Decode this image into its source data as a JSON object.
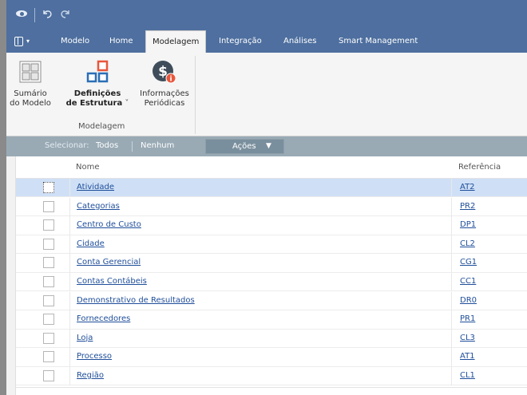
{
  "titlebar": {
    "icons": [
      "app-eye-icon",
      "undo-icon",
      "redo-icon"
    ]
  },
  "tabs": [
    {
      "label": "Modelo",
      "active": false
    },
    {
      "label": "Home",
      "active": false
    },
    {
      "label": "Modelagem",
      "active": true
    },
    {
      "label": "Integração",
      "active": false
    },
    {
      "label": "Análises",
      "active": false
    },
    {
      "label": "Smart Management",
      "active": false
    }
  ],
  "ribbon": {
    "buttons": [
      {
        "line1": "Sumário",
        "line2": "do Modelo",
        "icon": "summary-grid-icon"
      },
      {
        "line1": "Definições",
        "line2": "de Estrutura",
        "icon": "structure-icon",
        "has_dropdown": true
      },
      {
        "line1": "Informações",
        "line2": "Periódicas",
        "icon": "dollar-info-icon"
      }
    ],
    "group_label": "Modelagem"
  },
  "selection": {
    "label": "Selecionar:",
    "all": "Todos",
    "none": "Nenhum",
    "actions": "Ações"
  },
  "grid": {
    "columns": [
      "Nome",
      "Referência"
    ],
    "rows": [
      {
        "name": "Atividade",
        "ref": "AT2",
        "selected": true
      },
      {
        "name": "Categorias",
        "ref": "PR2"
      },
      {
        "name": "Centro de Custo",
        "ref": "DP1"
      },
      {
        "name": "Cidade",
        "ref": "CL2"
      },
      {
        "name": "Conta Gerencial",
        "ref": "CG1"
      },
      {
        "name": "Contas Contábeis",
        "ref": "CC1"
      },
      {
        "name": "Demonstrativo de Resultados",
        "ref": "DR0"
      },
      {
        "name": "Fornecedores",
        "ref": "PR1"
      },
      {
        "name": "Loja",
        "ref": "CL3"
      },
      {
        "name": "Processo",
        "ref": "AT1"
      },
      {
        "name": "Região",
        "ref": "CL1"
      }
    ]
  },
  "colors": {
    "titlebar": "#4e6f9f",
    "ribbon": "#f5f5f5",
    "selection_bar": "#99aab5",
    "selected_row": "#cfe0f6",
    "link": "#1f4e9a"
  }
}
